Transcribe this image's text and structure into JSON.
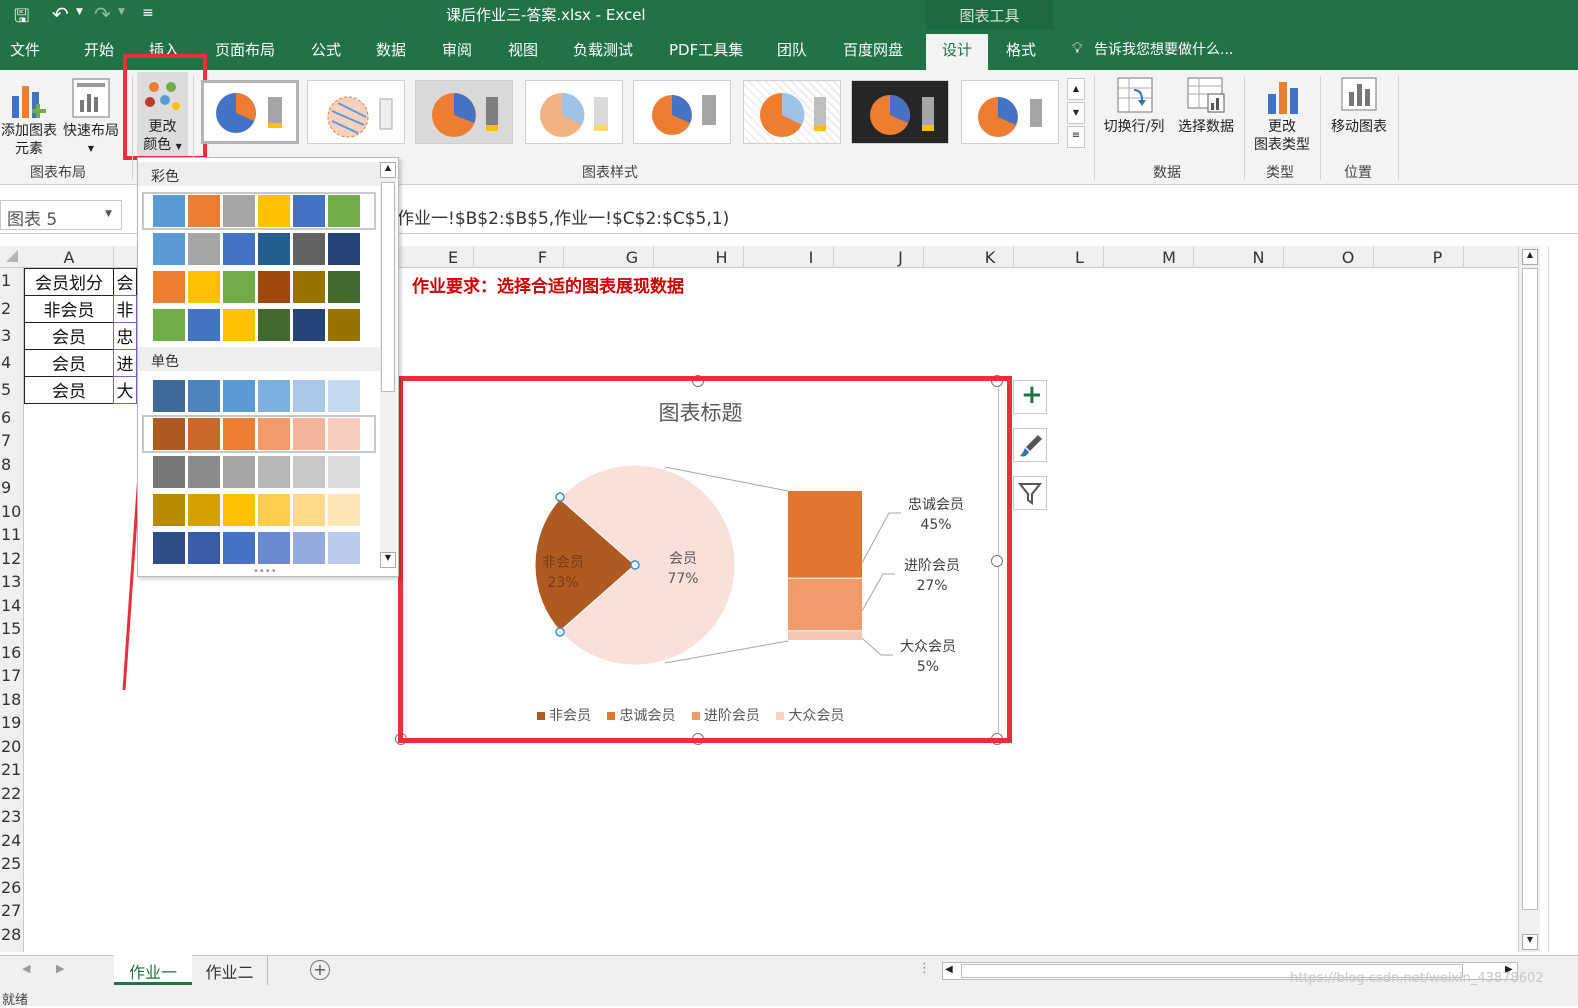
{
  "titlebar": {
    "title": "课后作业三-答案.xlsx - Excel",
    "context_tab": "图表工具"
  },
  "tabs": [
    "文件",
    "开始",
    "插入",
    "页面布局",
    "公式",
    "数据",
    "审阅",
    "视图",
    "负载测试",
    "PDF工具集",
    "团队",
    "百度网盘",
    "设计",
    "格式"
  ],
  "active_tab": "设计",
  "tell_me": "告诉我您想要做什么...",
  "ribbon": {
    "add_element": "添加图表\n元素",
    "quick_layout": "快速布局",
    "change_color_l1": "更改",
    "change_color_l2": "颜色",
    "group_layout": "图表布局",
    "group_styles": "图表样式",
    "switch_row_col": "切换行/列",
    "select_data": "选择数据",
    "group_data": "数据",
    "change_type_l1": "更改",
    "change_type_l2": "图表类型",
    "group_type": "类型",
    "move_chart": "移动图表",
    "group_location": "位置"
  },
  "formula": {
    "name_box": "图表 5",
    "text": "作业一!$B$2:$B$5,作业一!$C$2:$C$5,1)"
  },
  "columns": [
    "A",
    "E",
    "F",
    "G",
    "H",
    "I",
    "J",
    "K",
    "L",
    "M",
    "N",
    "O",
    "P"
  ],
  "rows": [
    "1",
    "2",
    "3",
    "4",
    "5",
    "6",
    "7",
    "8",
    "9",
    "10",
    "11",
    "12",
    "13",
    "14",
    "15",
    "16",
    "17",
    "18",
    "19",
    "20",
    "21",
    "22",
    "23",
    "24",
    "25",
    "26",
    "27",
    "28"
  ],
  "cells": {
    "a": [
      "会员划分",
      "非会员",
      "会员",
      "会员",
      "会员"
    ],
    "b": [
      "会",
      "非",
      "忠",
      "进",
      "大"
    ]
  },
  "instruction": "作业要求：选择合适的图表展现数据",
  "palette": {
    "section_colorful": "彩色",
    "section_mono": "单色",
    "colorful": [
      [
        "#5b9bd5",
        "#ed7d31",
        "#a5a5a5",
        "#ffc000",
        "#4472c4",
        "#70ad47"
      ],
      [
        "#5b9bd5",
        "#a5a5a5",
        "#4472c4",
        "#255e91",
        "#636363",
        "#264478"
      ],
      [
        "#ed7d31",
        "#ffc000",
        "#70ad47",
        "#9e480e",
        "#997300",
        "#43682b"
      ],
      [
        "#70ad47",
        "#4472c4",
        "#ffc000",
        "#43682b",
        "#264478",
        "#997300"
      ]
    ],
    "mono": [
      [
        "#3f6b9a",
        "#4d84be",
        "#5b9bd5",
        "#7eb0df",
        "#a9c8ea",
        "#c5d9f1"
      ],
      [
        "#ae5a21",
        "#c8692b",
        "#ed7d31",
        "#f19a6c",
        "#f5b59a",
        "#f8cbbd"
      ],
      [
        "#767676",
        "#8c8c8c",
        "#a5a5a5",
        "#b7b7b7",
        "#c9c9c9",
        "#dbdbdb"
      ],
      [
        "#b98a00",
        "#d6a000",
        "#ffc000",
        "#ffcd4d",
        "#ffd98a",
        "#ffe5b8"
      ],
      [
        "#2f4d89",
        "#385ca6",
        "#4472c4",
        "#6a8ad0",
        "#95aadf",
        "#bccbec"
      ]
    ]
  },
  "chart_data": {
    "type": "pie",
    "title": "图表标题",
    "pie": [
      {
        "name": "非会员",
        "pct": "23%",
        "value": 23,
        "color": "#ae5a21"
      },
      {
        "name": "会员",
        "pct": "77%",
        "value": 77,
        "color": "#f9e1da"
      }
    ],
    "bar": [
      {
        "name": "忠诚会员",
        "pct": "45%",
        "value": 45,
        "color": "#e07530"
      },
      {
        "name": "进阶会员",
        "pct": "27%",
        "value": 27,
        "color": "#f19a6c"
      },
      {
        "name": "大众会员",
        "pct": "5%",
        "value": 5,
        "color": "#f5c6b5"
      }
    ],
    "legend": [
      {
        "name": "非会员",
        "color": "#ae5a21"
      },
      {
        "name": "忠诚会员",
        "color": "#e07530"
      },
      {
        "name": "进阶会员",
        "color": "#f19a6c"
      },
      {
        "name": "大众会员",
        "color": "#f9d2c4"
      }
    ]
  },
  "sheets": [
    "作业一",
    "作业二"
  ],
  "active_sheet": "作业一",
  "status": {
    "text": "就绪",
    "watermark": "https://blog.csdn.net/weixin_43878602"
  }
}
